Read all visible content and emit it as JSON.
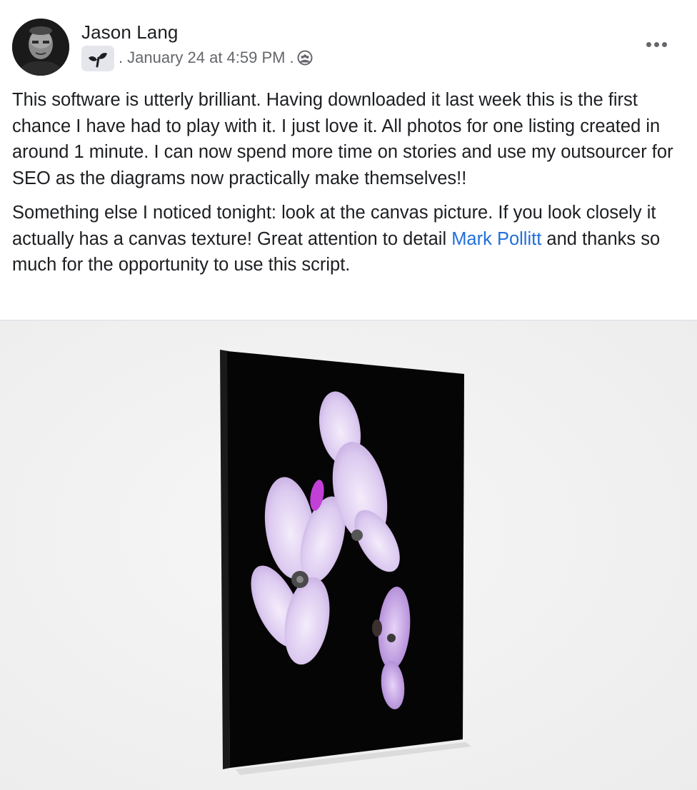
{
  "post": {
    "author": "Jason Lang",
    "separator_1": ".",
    "timestamp": "January 24 at 4:59 PM",
    "separator_2": ".",
    "badge_icon": "new-member-sprout-icon",
    "audience_icon": "members-group-icon",
    "more_icon": "more-options-icon",
    "paragraphs": [
      {
        "text": "This software is utterly brilliant.  Having downloaded it last week this is the first chance I have had to play with it.  I just love it.  All photos for one listing created in around 1 minute.  I can now spend more time on stories and use my outsourcer for SEO as the diagrams now practically make themselves!!"
      },
      {
        "text_before": "Something else I noticed tonight: look at the canvas picture.  If you look closely it actually has a canvas texture!  Great attention to detail ",
        "mention": "Mark Pollitt",
        "text_after": " and thanks so much for the opportunity to use this script."
      }
    ],
    "colors": {
      "text": "#1c1e21",
      "meta": "#65676b",
      "mention": "#216fdb",
      "badge_bg": "#e4e6eb",
      "canvas": "#050505",
      "flower": "#d9c3ef"
    }
  }
}
